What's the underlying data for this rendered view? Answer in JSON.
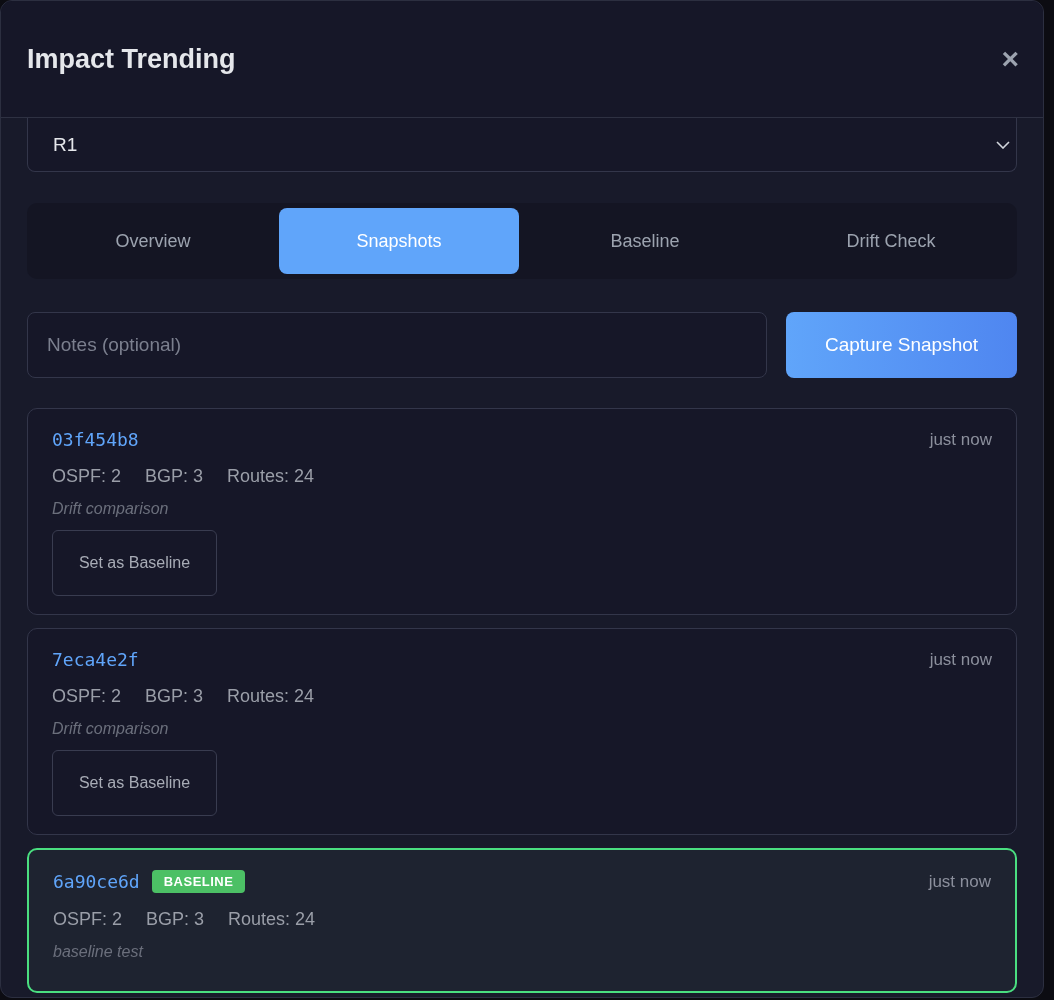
{
  "dialog": {
    "title": "Impact Trending",
    "close": "×"
  },
  "router_select": {
    "value": "R1"
  },
  "tabs": [
    {
      "label": "Overview",
      "selected": false
    },
    {
      "label": "Snapshots",
      "selected": true
    },
    {
      "label": "Baseline",
      "selected": false
    },
    {
      "label": "Drift Check",
      "selected": false
    }
  ],
  "notes": {
    "placeholder": "Notes (optional)"
  },
  "capture_button": "Capture Snapshot",
  "snapshots": [
    {
      "id": "03f454b8",
      "time": "just now",
      "stats": [
        "OSPF: 2",
        "BGP: 3",
        "Routes: 24"
      ],
      "note": "Drift comparison",
      "baseline": false,
      "button": "Set as Baseline"
    },
    {
      "id": "7eca4e2f",
      "time": "just now",
      "stats": [
        "OSPF: 2",
        "BGP: 3",
        "Routes: 24"
      ],
      "note": "Drift comparison",
      "baseline": false,
      "button": "Set as Baseline"
    },
    {
      "id": "6a90ce6d",
      "time": "just now",
      "stats": [
        "OSPF: 2",
        "BGP: 3",
        "Routes: 24"
      ],
      "note": "baseline test",
      "baseline": true,
      "badge": "BASELINE"
    }
  ]
}
